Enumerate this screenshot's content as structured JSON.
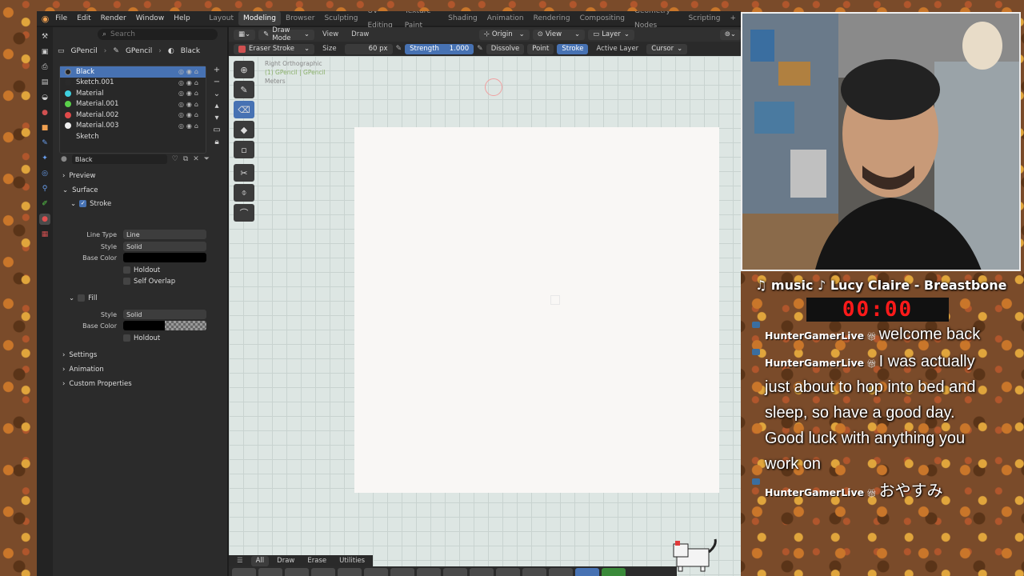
{
  "menubar": {
    "logo_icon": "blender-logo-icon",
    "menus": [
      "File",
      "Edit",
      "Render",
      "Window",
      "Help"
    ],
    "workspaces": [
      "Layout",
      "Modeling",
      "Browser",
      "Sculpting",
      "UV Editing",
      "Texture Paint",
      "Shading",
      "Animation",
      "Rendering",
      "Compositing",
      "Geometry Nodes",
      "Scripting",
      "+"
    ],
    "active_workspace": "Modeling"
  },
  "props_header": {
    "search_placeholder": "Search",
    "breadcrumb": [
      "GPencil",
      "GPencil",
      "Black"
    ]
  },
  "material_slots": [
    {
      "name": "Black",
      "color": "#2a2a2a",
      "selected": true
    },
    {
      "name": "Sketch.001",
      "color": "#2a2a2a"
    },
    {
      "name": "Material",
      "color": "#3fd0e0"
    },
    {
      "name": "Material.001",
      "color": "#5ad04a"
    },
    {
      "name": "Material.002",
      "color": "#e04a4a"
    },
    {
      "name": "Material.003",
      "color": "#f0f0f0"
    },
    {
      "name": "Sketch",
      "color": ""
    }
  ],
  "material_field": "Black",
  "sections": {
    "preview": "Preview",
    "surface": "Surface",
    "stroke": "Stroke",
    "line_type_label": "Line Type",
    "line_type_value": "Line",
    "style_label": "Style",
    "style_value": "Solid",
    "base_color_label": "Base Color",
    "holdout": "Holdout",
    "self_overlap": "Self Overlap",
    "fill": "Fill",
    "fill_style_label": "Style",
    "fill_style_value": "Solid",
    "fill_base_color_label": "Base Color",
    "fill_holdout": "Holdout",
    "settings": "Settings",
    "animation": "Animation",
    "custom_properties": "Custom Properties"
  },
  "viewport": {
    "mode": "Draw Mode",
    "header_menus": [
      "View",
      "Draw"
    ],
    "origin": "Origin",
    "view": "View",
    "layer": "Layer",
    "tool_name": "Eraser Stroke",
    "size_label": "Size",
    "size_value": "60 px",
    "strength_label": "Strength",
    "strength_value": "1.000",
    "mode_options": [
      "Dissolve",
      "Point",
      "Stroke"
    ],
    "active_mode": "Stroke",
    "active_layer": "Active Layer",
    "cursor": "Cursor",
    "view_name": "Right Orthographic",
    "object_info": "(1) GPencil | GPencil",
    "units": "Meters",
    "bottom_tabs": [
      "All",
      "Draw",
      "Erase",
      "Utilities"
    ]
  },
  "stream": {
    "music": "♫ music ♪ Lucy Claire - Breastbone",
    "timer": "00:00",
    "messages": [
      {
        "user": "HunterGamerLive",
        "text": "welcome back"
      },
      {
        "user": "HunterGamerLive",
        "text": "I was actually just about to hop into bed and sleep, so have a good day. Good luck with anything you work on"
      },
      {
        "user": "HunterGamerLive",
        "text": "おやすみ"
      }
    ]
  },
  "colors": {
    "accent": "#4772b3",
    "timer_red": "#ff1a1a"
  }
}
